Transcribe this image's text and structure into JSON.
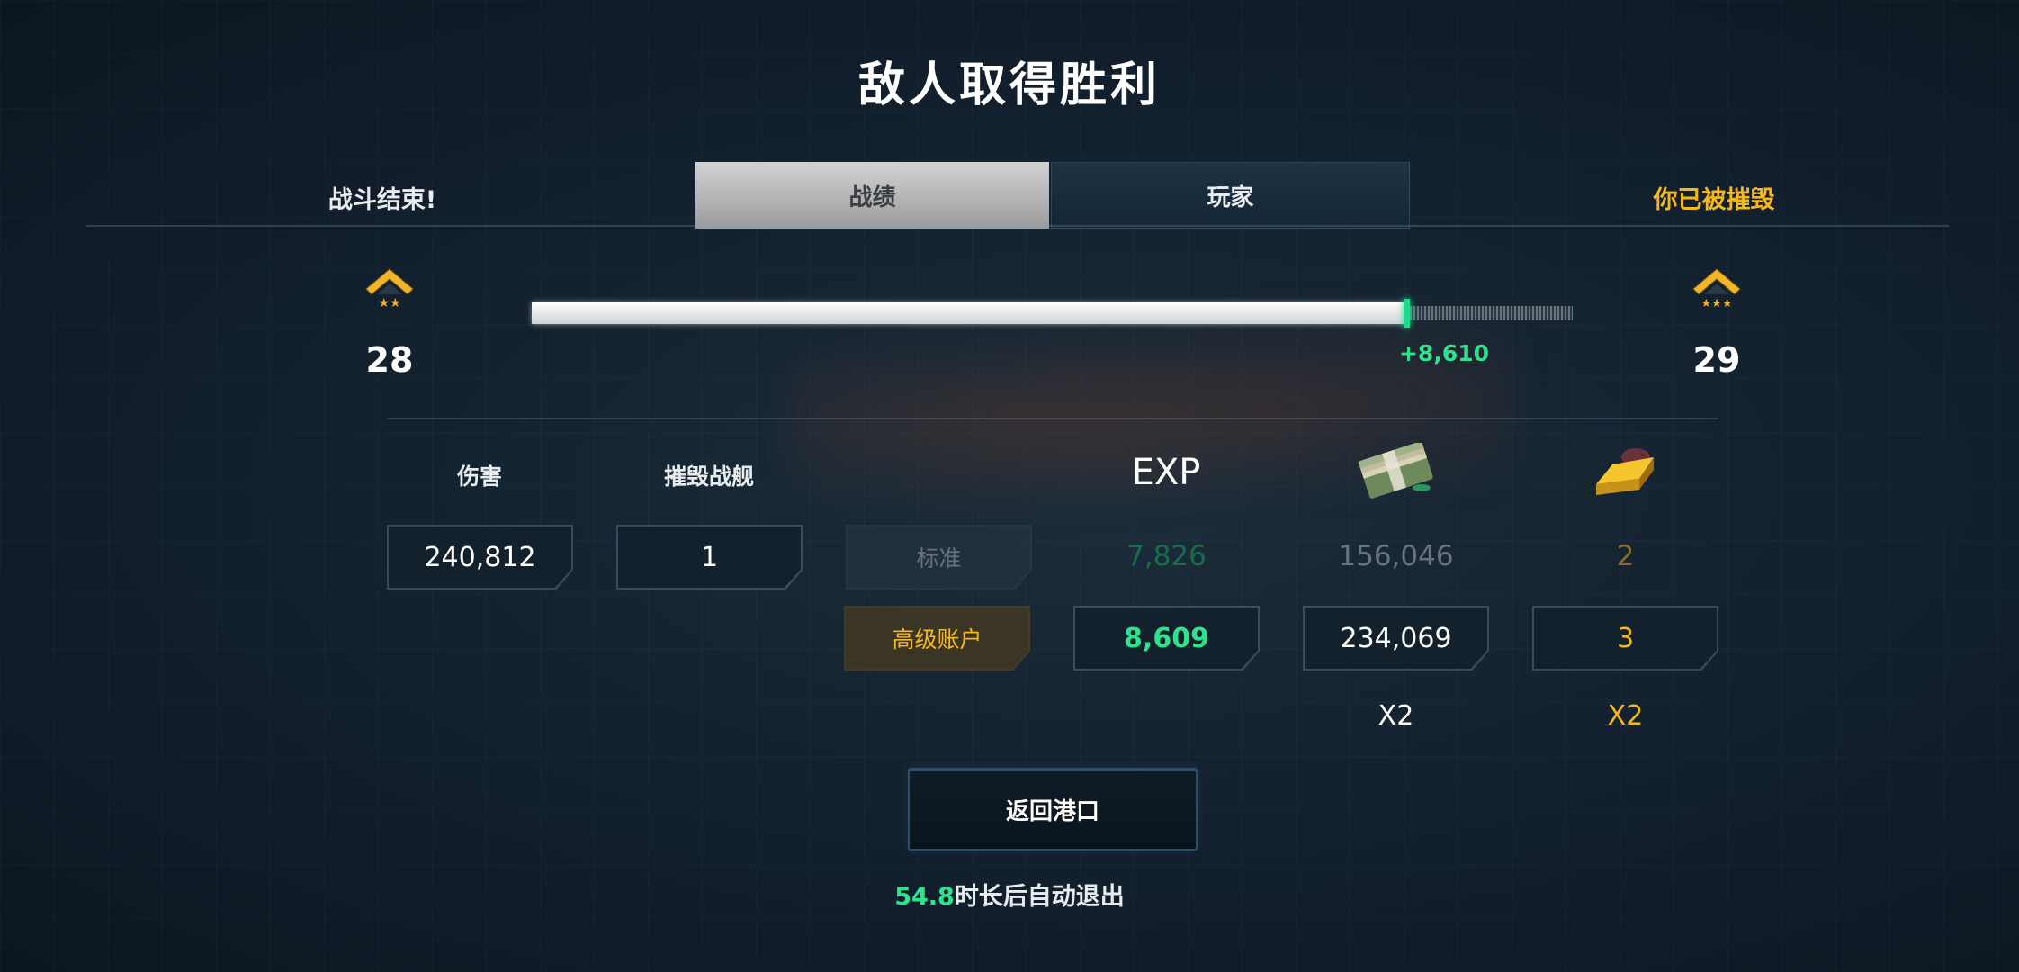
{
  "header": {
    "title": "敌人取得胜利",
    "battle_over": "战斗结束!",
    "destroyed_status": "你已被摧毁",
    "tabs": [
      {
        "label": "战绩",
        "active": true
      },
      {
        "label": "玩家",
        "active": false
      }
    ]
  },
  "rank": {
    "current_level": "28",
    "next_level": "29",
    "xp_progress": 0.84,
    "xp_gain": "+8,610"
  },
  "stats": {
    "damage_label": "伤害",
    "damage_value": "240,812",
    "kills_label": "摧毁战舰",
    "kills_value": "1"
  },
  "rewards": {
    "exp_header": "EXP",
    "money_icon": "cash-stack-icon",
    "gold_icon": "gold-bar-icon",
    "standard": {
      "label": "标准",
      "exp": "7,826",
      "money": "156,046",
      "gold": "2"
    },
    "premium": {
      "label": "高级账户",
      "exp": "8,609",
      "money": "234,069",
      "gold": "3"
    },
    "money_multiplier": "X2",
    "gold_multiplier": "X2"
  },
  "actions": {
    "return_label": "返回港口",
    "countdown": "54.8",
    "autoexit_suffix": "时长后自动退出"
  },
  "colors": {
    "accent_green": "#2ee38e",
    "accent_gold": "#f4b81c",
    "background": "#142230"
  }
}
